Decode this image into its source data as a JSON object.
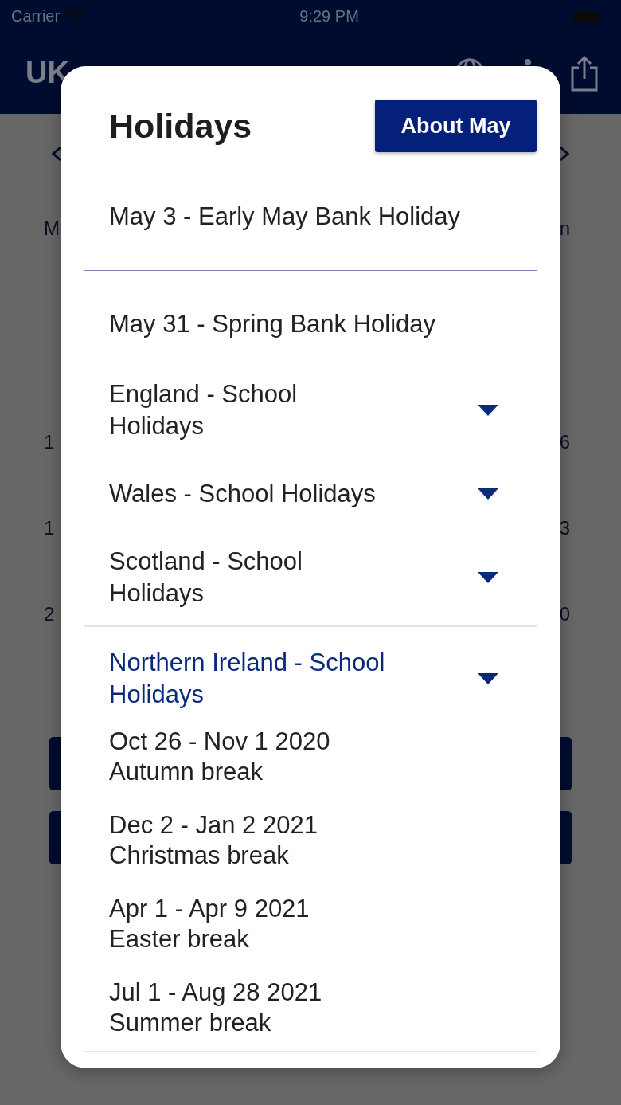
{
  "status_bar": {
    "carrier": "Carrier",
    "time": "9:29 PM"
  },
  "nav_bar": {
    "title": "UK"
  },
  "calendar_behind": {
    "rows": [
      [
        "M",
        "n"
      ],
      [
        "1",
        "6"
      ],
      [
        "1",
        "3"
      ],
      [
        "2",
        "0"
      ]
    ]
  },
  "modal": {
    "title": "Holidays",
    "about_button": "About May",
    "bank_holidays": [
      {
        "label": "May 3 - Early May Bank Holiday"
      },
      {
        "label": "May 31 - Spring Bank Holiday"
      }
    ],
    "regions": [
      {
        "label": "England - School Holidays",
        "expanded": false
      },
      {
        "label": "Wales - School Holidays",
        "expanded": false
      },
      {
        "label": "Scotland - School Holidays",
        "expanded": false
      },
      {
        "label": "Northern Ireland - School Holidays",
        "expanded": true,
        "children": [
          {
            "dates": "Oct 26 - Nov 1 2020",
            "name": "Autumn break"
          },
          {
            "dates": "Dec 2 - Jan 2 2021",
            "name": "Christmas break"
          },
          {
            "dates": "Apr 1 - Apr 9 2021",
            "name": "Easter break"
          },
          {
            "dates": "Jul 1 - Aug 28 2021",
            "name": "Summer break"
          }
        ]
      }
    ]
  }
}
